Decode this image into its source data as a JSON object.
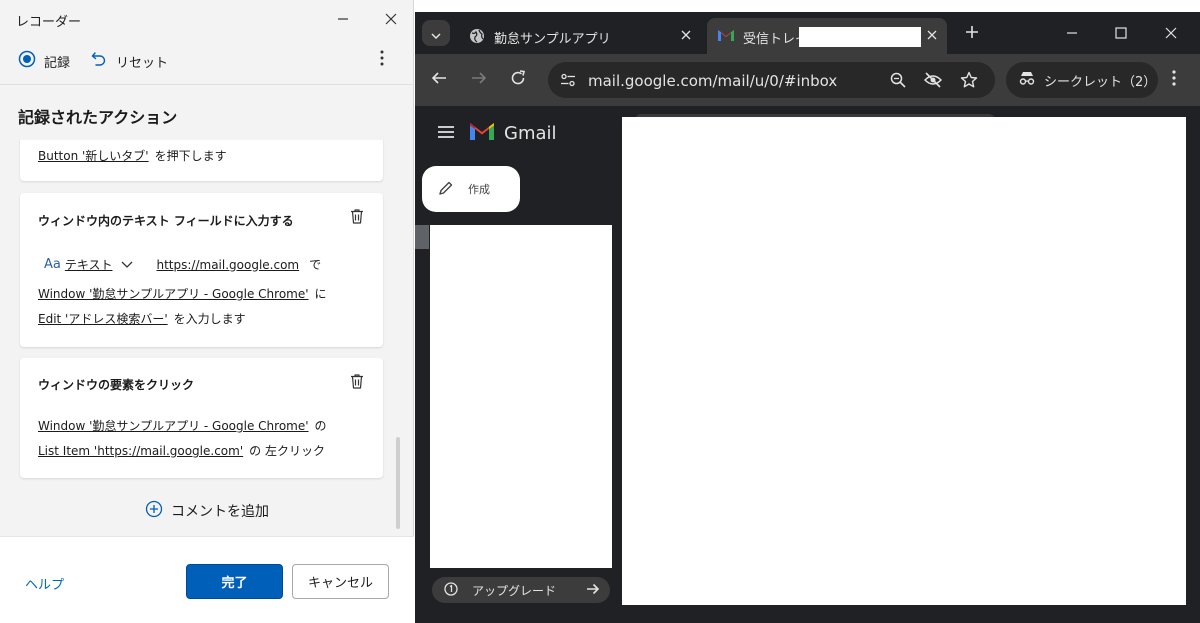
{
  "recorder": {
    "title": "レコーダー",
    "toolbar": {
      "record": "記録",
      "reset": "リセット"
    },
    "heading": "記録されたアクション",
    "actions": [
      {
        "lines": [
          {
            "a": "Button '新しいタブ'",
            "b": "を押下します"
          }
        ]
      },
      {
        "title": "ウィンドウ内のテキスト フィールドに入力する",
        "input_type": "テキスト",
        "input_value": "https://mail.google.com",
        "input_suffix": "で",
        "lines": [
          {
            "a": "Window '勤怠サンプルアプリ - Google Chrome'",
            "b": "に"
          },
          {
            "a": "Edit 'アドレス検索バー'",
            "b": "を入力します"
          }
        ]
      },
      {
        "title": "ウィンドウの要素をクリック",
        "lines": [
          {
            "a": "Window '勤怠サンプルアプリ - Google Chrome'",
            "b": "の"
          },
          {
            "a": "List Item 'https://mail.google.com'",
            "b": "の 左クリック"
          }
        ]
      }
    ],
    "add_comment": "コメントを追加",
    "footer": {
      "help": "ヘルプ",
      "done": "完了",
      "cancel": "キャンセル"
    }
  },
  "chrome": {
    "tabs": [
      {
        "title": "勤怠サンプルアプリ"
      },
      {
        "title": "受信トレイ"
      }
    ],
    "url": "mail.google.com/mail/u/0/#inbox",
    "incognito_label": "シークレット（2）",
    "gmail": {
      "logo_text": "Gmail",
      "compose": "作成",
      "upgrade": "アップグレード"
    }
  },
  "colors": {
    "primary_button": "#005fb8",
    "link": "#0067c0",
    "chrome_dark": "#202124",
    "chrome_toolbar": "#3c3c3c"
  }
}
